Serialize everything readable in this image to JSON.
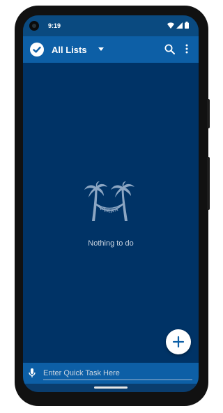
{
  "status_bar": {
    "time": "9:19",
    "icons": [
      "wifi-icon",
      "signal-icon",
      "battery-icon"
    ]
  },
  "app_bar": {
    "title": "All Lists",
    "icons": [
      "check-circle-icon",
      "dropdown-arrow-icon",
      "search-icon",
      "more-vert-icon"
    ]
  },
  "empty_state": {
    "illustration": "palm-trees-hammock-icon",
    "message": "Nothing to do"
  },
  "fab": {
    "icon": "plus-icon"
  },
  "quick_task": {
    "icon": "mic-icon",
    "placeholder": "Enter Quick Task Here",
    "value": ""
  },
  "colors": {
    "background": "#003366",
    "app_bar": "#0d5fa6",
    "text_light": "#c9d4e0",
    "accent": "#0d5fa6"
  }
}
